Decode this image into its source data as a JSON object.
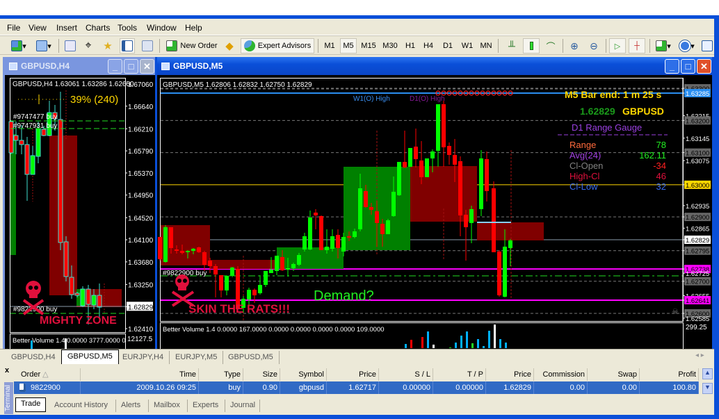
{
  "menu": [
    "File",
    "View",
    "Insert",
    "Charts",
    "Tools",
    "Window",
    "Help"
  ],
  "toolbar": {
    "new_order": "New Order",
    "expert_advisors": "Expert Advisors",
    "timeframes": [
      "M1",
      "M5",
      "M15",
      "M30",
      "H1",
      "H4",
      "D1",
      "W1",
      "MN"
    ],
    "active_timeframe": "M5"
  },
  "windows": {
    "h4": {
      "title": "GBPUSD,H4",
      "header": "GBPUSD,H4  1.63061 1.63286 1.62650",
      "gauge": "39% (240)",
      "orders": [
        "#9747477 buy",
        "#9747931 buy",
        "#9822900 buy"
      ],
      "zone_label": "MIGHTY ZONE",
      "axis": [
        "1.67060",
        "1.66640",
        "1.66210",
        "1.65790",
        "1.65370",
        "1.64950",
        "1.64520",
        "1.64100",
        "1.63680",
        "1.63250",
        "1.62829",
        "1.62410"
      ],
      "current_price": "1.62829",
      "volume_header": "Better Volume 1.4 0.0000 3777.0000 0",
      "volume_axis": "12127.5"
    },
    "m5": {
      "title": "GBPUSD,M5",
      "header": "GBPUSD,M5  1.62806 1.62832 1.62750 1.62829",
      "w1_high": "W1(O) High",
      "d1_high": "D1(O) High",
      "bar_end": "M5 Bar end: 1 m 25 s",
      "price": "1.62829",
      "symbol": "GBPUSD",
      "gauge_title": "D1 Range Gauge",
      "gauge_rows": [
        {
          "label": "Range",
          "value": "78",
          "label_color": "#ff6a3c",
          "value_color": "#22ee22"
        },
        {
          "label": "Avg(24)",
          "value": "162.11",
          "label_color": "#a040e0",
          "value_color": "#22ee22"
        },
        {
          "label": "Cl-Open",
          "value": "-34",
          "label_color": "#808080",
          "value_color": "#ff2020"
        },
        {
          "label": "High-Cl",
          "value": "46",
          "label_color": "#e0103c",
          "value_color": "#e0103c"
        },
        {
          "label": "Cl-Low",
          "value": "32",
          "label_color": "#3a6cf0",
          "value_color": "#3a6cf0"
        }
      ],
      "order_label": "#9822900 buy",
      "skull_label": "SKIN THE RATS!!!",
      "demand_label": "Demand?",
      "axis": [
        {
          "v": "1.63300",
          "t": "grid"
        },
        {
          "v": "1.63285",
          "t": "blue"
        },
        {
          "v": "1.63215",
          "t": "n"
        },
        {
          "v": "1.63200",
          "t": "grid"
        },
        {
          "v": "1.63145",
          "t": "n"
        },
        {
          "v": "1.63100",
          "t": "grid"
        },
        {
          "v": "1.63075",
          "t": "n"
        },
        {
          "v": "1.63000",
          "t": "yellow"
        },
        {
          "v": "1.62935",
          "t": "n"
        },
        {
          "v": "1.62900",
          "t": "grid"
        },
        {
          "v": "1.62865",
          "t": "n"
        },
        {
          "v": "1.62829",
          "t": "current"
        },
        {
          "v": "1.62795",
          "t": "grid"
        },
        {
          "v": "1.62738",
          "t": "magenta"
        },
        {
          "v": "1.62725",
          "t": "n"
        },
        {
          "v": "1.62700",
          "t": "grid"
        },
        {
          "v": "1.62655",
          "t": "n"
        },
        {
          "v": "1.62641",
          "t": "magenta"
        },
        {
          "v": "1.62600",
          "t": "grid"
        },
        {
          "v": "1.62585",
          "t": "n"
        }
      ],
      "volume_header": "Better Volume 1.4 0.0000 167.0000 0.0000 0.0000 0.0000 0.0000 109.0000",
      "volume_axis": "299.25"
    }
  },
  "chart_tabs": [
    "GBPUSD,H4",
    "GBPUSD,M5",
    "EURJPY,H4",
    "EURJPY,M5",
    "GBPUSD,M5"
  ],
  "active_chart_tab": 1,
  "terminal": {
    "label": "Terminal",
    "close": "x",
    "columns": [
      "Order",
      "Time",
      "Type",
      "Size",
      "Symbol",
      "Price",
      "S / L",
      "T / P",
      "Price",
      "Commission",
      "Swap",
      "Profit"
    ],
    "rows": [
      [
        "9822900",
        "2009.10.26 09:25",
        "buy",
        "0.90",
        "gbpusd",
        "1.62717",
        "0.00000",
        "0.00000",
        "1.62829",
        "0.00",
        "0.00",
        "100.80"
      ]
    ],
    "tabs": [
      "Trade",
      "Account History",
      "Alerts",
      "Mailbox",
      "Experts",
      "Journal"
    ],
    "active_tab": 0
  },
  "colors": {
    "bull": "#00ff00",
    "bear": "#ff0000",
    "wick": "#40e0d0",
    "xp_blue": "#0a4fd8",
    "selection": "#316ac5"
  }
}
